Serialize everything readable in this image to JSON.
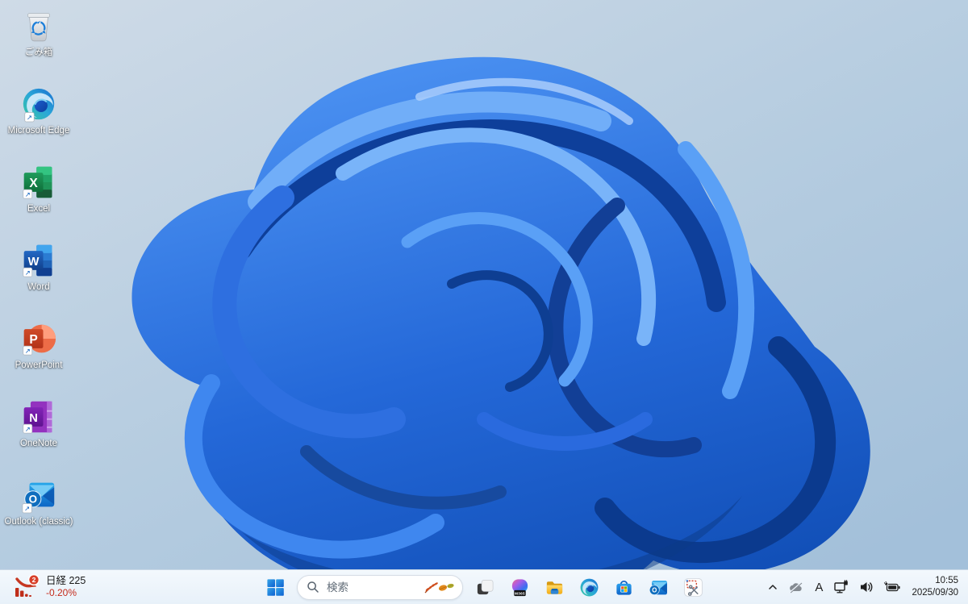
{
  "wallpaper": {
    "name": "windows-11-bloom",
    "sky_top": "#cdd9e6",
    "sky_bottom": "#a3c0da",
    "bloom_primary": "#2e74e8",
    "bloom_dark": "#0d3f96",
    "bloom_light": "#6aa8f8"
  },
  "desktop": {
    "icons": [
      {
        "name": "recycle-bin",
        "label": "ごみ箱"
      },
      {
        "name": "microsoft-edge",
        "label": "Microsoft Edge"
      },
      {
        "name": "excel",
        "label": "Excel"
      },
      {
        "name": "word",
        "label": "Word"
      },
      {
        "name": "powerpoint",
        "label": "PowerPoint"
      },
      {
        "name": "onenote",
        "label": "OneNote"
      },
      {
        "name": "outlook-classic",
        "label": "Outlook (classic)"
      }
    ]
  },
  "taskbar": {
    "widget": {
      "badge": "2",
      "title": "日経 225",
      "change": "-0.20%",
      "change_color": "#c42b1c",
      "icon": "stock-down-chart-icon"
    },
    "start": {
      "icon": "windows-start-icon"
    },
    "search": {
      "placeholder": "検索",
      "decoration": "autumn-leaves-icon"
    },
    "apps": [
      {
        "name": "task-view"
      },
      {
        "name": "m365-copilot",
        "badge": "M365"
      },
      {
        "name": "file-explorer"
      },
      {
        "name": "microsoft-edge"
      },
      {
        "name": "microsoft-store"
      },
      {
        "name": "outlook"
      },
      {
        "name": "snipping-tool"
      }
    ],
    "tray": {
      "icons": [
        "chevron-up",
        "onedrive-offline",
        "ime",
        "ethernet-network",
        "volume",
        "battery-charging"
      ],
      "ime_label": "A",
      "time": "10:55",
      "date": "2025/09/30"
    }
  },
  "colors": {
    "taskbar_bg": "#eef4fb",
    "accent_blue": "#0b63c8",
    "widget_red": "#c6331f",
    "ms_red": "#f25022",
    "ms_green": "#7fba00",
    "ms_blue": "#00a4ef",
    "ms_yellow": "#ffb900"
  }
}
